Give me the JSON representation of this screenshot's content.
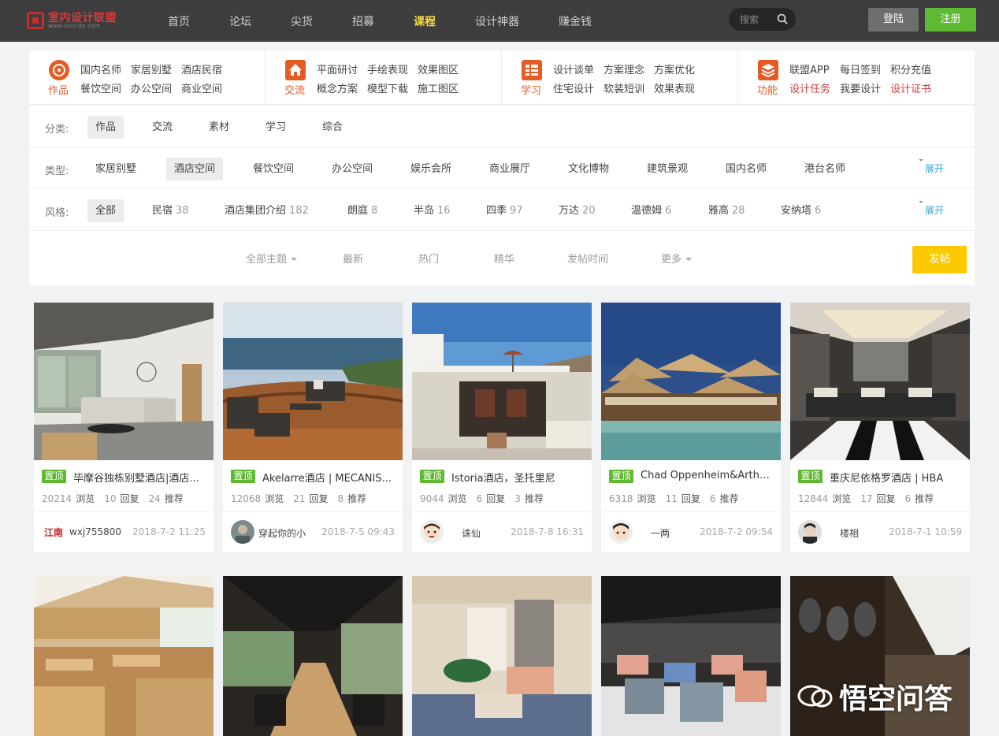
{
  "header": {
    "logo_text": "室内设计联盟",
    "logo_sub": "www.cool-de.com",
    "nav": [
      "首页",
      "论坛",
      "尖货",
      "招募",
      "课程",
      "设计神器",
      "赚金钱"
    ],
    "active_nav": "课程",
    "search_placeholder": "搜索",
    "login_label": "登陆",
    "register_label": "注册"
  },
  "categories": [
    {
      "icon": "works-icon",
      "label": "作品",
      "links": [
        "国内名师",
        "家居别墅",
        "酒店民宿",
        "餐饮空间",
        "办公空间",
        "商业空间"
      ]
    },
    {
      "icon": "home-exchange-icon",
      "label": "交流",
      "links": [
        "平面研讨",
        "手绘表现",
        "效果图区",
        "概念方案",
        "模型下载",
        "施工图区"
      ]
    },
    {
      "icon": "study-list-icon",
      "label": "学习",
      "links": [
        "设计谈单",
        "方案理念",
        "方案优化",
        "住宅设计",
        "软装短训",
        "效果表现"
      ]
    },
    {
      "icon": "layers-function-icon",
      "label": "功能",
      "links": [
        "联盟APP",
        "每日签到",
        "积分充值",
        "设计任务",
        "我要设计",
        "设计证书"
      ],
      "red": [
        3,
        5
      ]
    }
  ],
  "filters": {
    "category": {
      "label": "分类:",
      "options": [
        "作品",
        "交流",
        "素材",
        "学习",
        "综合"
      ],
      "selected": 0
    },
    "type": {
      "label": "类型:",
      "options": [
        "家居别墅",
        "酒店空间",
        "餐饮空间",
        "办公空间",
        "娱乐会所",
        "商业展厅",
        "文化博物",
        "建筑景观",
        "国内名师",
        "港台名师"
      ],
      "selected": 1,
      "expand": "展开"
    },
    "style": {
      "label": "风格:",
      "options": [
        {
          "name": "全部",
          "count": ""
        },
        {
          "name": "民宿",
          "count": "38"
        },
        {
          "name": "酒店集团介绍",
          "count": "182"
        },
        {
          "name": "朗庭",
          "count": "8"
        },
        {
          "name": "半岛",
          "count": "16"
        },
        {
          "name": "四季",
          "count": "97"
        },
        {
          "name": "万达",
          "count": "20"
        },
        {
          "name": "温德姆",
          "count": "6"
        },
        {
          "name": "雅高",
          "count": "28"
        },
        {
          "name": "安纳塔",
          "count": "6"
        }
      ],
      "selected": 0,
      "expand": "展开"
    },
    "sort": [
      "全部主题",
      "最新",
      "热门",
      "精华",
      "发帖时间",
      "更多"
    ],
    "post_label": "发帖"
  },
  "cards": [
    {
      "tag": "置顶",
      "title": "毕摩谷独栋别墅酒店|酒店...",
      "views": "20214",
      "replies": "10",
      "recs": "24",
      "author": "wxj755800",
      "date": "2018-7-2 11:25"
    },
    {
      "tag": "置顶",
      "title": "Akelarre酒店 | MECANIS...",
      "views": "12068",
      "replies": "21",
      "recs": "8",
      "author": "穿起你的小",
      "date": "2018-7-5 09:43"
    },
    {
      "tag": "置顶",
      "title": "Istoria酒店，圣托里尼",
      "views": "9044",
      "replies": "6",
      "recs": "3",
      "author": "诛仙",
      "date": "2018-7-8 16:31"
    },
    {
      "tag": "置顶",
      "title": "Chad Oppenheim&Arthu...",
      "views": "6318",
      "replies": "11",
      "recs": "6",
      "author": "一两",
      "date": "2018-7-2 09:54"
    },
    {
      "tag": "置顶",
      "title": "重庆尼依格罗酒店 | HBA",
      "views": "12844",
      "replies": "17",
      "recs": "6",
      "author": "楼相",
      "date": "2018-7-1 10:59"
    }
  ],
  "stat_labels": {
    "views": "浏览",
    "replies": "回复",
    "recs": "推荐"
  },
  "avatar_text": "江南",
  "watermark": "悟空问答"
}
